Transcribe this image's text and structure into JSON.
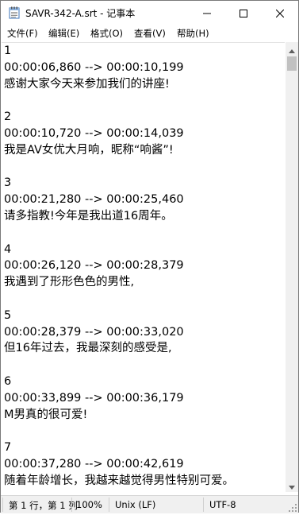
{
  "window": {
    "title": "SAVR-342-A.srt - 记事本",
    "icon": "notepad-icon"
  },
  "controls": {
    "minimize_icon": "minimize-icon",
    "maximize_icon": "maximize-icon",
    "close_icon": "close-icon"
  },
  "menu": {
    "items": [
      {
        "label": "文件(F)"
      },
      {
        "label": "编辑(E)"
      },
      {
        "label": "格式(O)"
      },
      {
        "label": "查看(V)"
      },
      {
        "label": "帮助(H)"
      }
    ]
  },
  "document": {
    "lines": [
      "1",
      "00:00:06,860 --> 00:00:10,199",
      "感谢大家今天来参加我们的讲座!",
      "",
      "2",
      "00:00:10,720 --> 00:00:14,039",
      "我是AV女优大月响，昵称“响酱”!",
      "",
      "3",
      "00:00:21,280 --> 00:00:25,460",
      "请多指教!今年是我出道16周年。",
      "",
      "4",
      "00:00:26,120 --> 00:00:28,379",
      "我遇到了形形色色的男性,",
      "",
      "5",
      "00:00:28,379 --> 00:00:33,020",
      "但16年过去，我最深刻的感受是,",
      "",
      "6",
      "00:00:33,899 --> 00:00:36,179",
      "M男真的很可爱!",
      "",
      "7",
      "00:00:37,280 --> 00:00:42,619",
      "随着年龄增长，我越来越觉得男性特别可爱。"
    ]
  },
  "status": {
    "position": "第 1 行，第 1 列",
    "zoom": "100%",
    "line_ending": "Unix (LF)",
    "encoding": "UTF-8"
  }
}
